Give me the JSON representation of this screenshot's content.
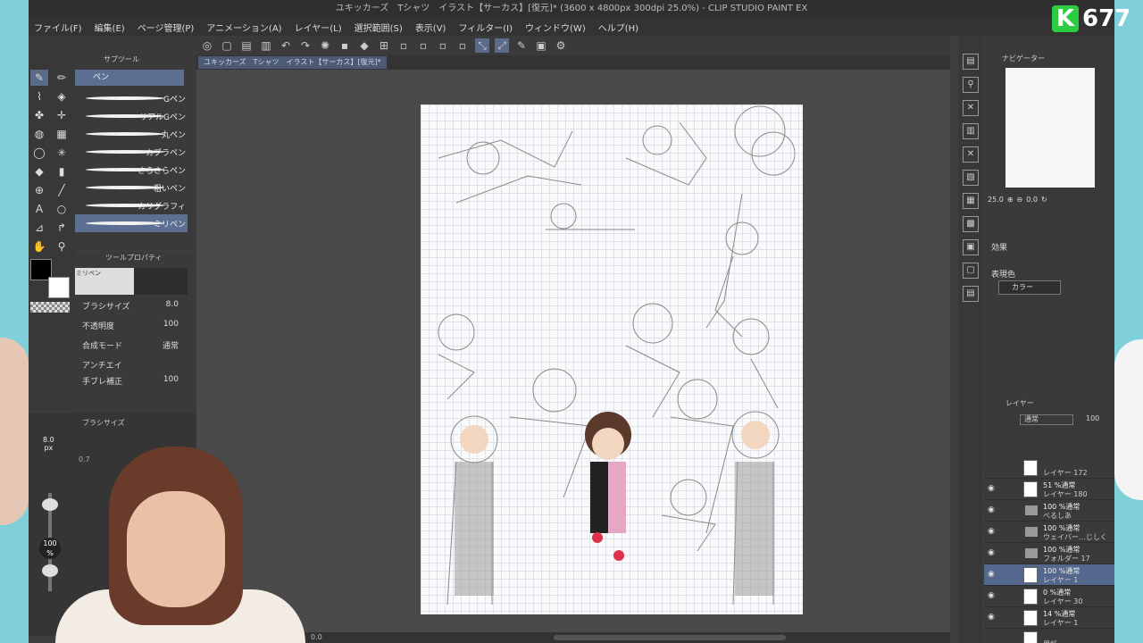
{
  "window": {
    "title": "ユキッカーズ　Tシャツ　イラスト【サーカス】[復元]* (3600 x 4800px 300dpi 25.0%)  - CLIP STUDIO PAINT EX"
  },
  "menu": [
    "ファイル(F)",
    "編集(E)",
    "ページ管理(P)",
    "アニメーション(A)",
    "レイヤー(L)",
    "選択範囲(S)",
    "表示(V)",
    "フィルター(I)",
    "ウィンドウ(W)",
    "ヘルプ(H)"
  ],
  "doc_tab": {
    "label": "ユキッカーズ　Tシャツ　イラスト【サーカス】[復元]*"
  },
  "subtool": {
    "header": "サブツール",
    "tab": "ペン",
    "brushes": [
      "Gペン",
      "リアルGペン",
      "丸ペン",
      "カブラペン",
      "さらさらペン",
      "粗いペン",
      "カリグラフィ",
      "ミリペン"
    ]
  },
  "tool_property": {
    "header": "ツールプロパティ",
    "preview_label": "ミリペン",
    "brush_size_label": "ブラシサイズ",
    "brush_size_value": "8.0",
    "opacity_label": "不透明度",
    "opacity_value": "100",
    "blend_label": "合成モード",
    "blend_value": "通常",
    "antialias_label": "アンチエイ",
    "stabilize_label": "手ブレ補正",
    "stabilize_value": "100"
  },
  "brush_size_panel": {
    "header": "ブラシサイズ",
    "size": "8.0",
    "unit": "px",
    "secondary": "0.7",
    "percent": "100",
    "percent_unit": "%"
  },
  "navigator": {
    "header": "ナビゲーター",
    "zoom": "25.0",
    "rotate": "0.0"
  },
  "effect_panel": {
    "header": "効果",
    "expression_label": "表現色",
    "expression_value": "カラー"
  },
  "layer_panel": {
    "header": "レイヤー",
    "blend": "通常",
    "opacity": "100",
    "layers": [
      {
        "mode": "",
        "name": "レイヤー 172",
        "selected": false,
        "folder": false
      },
      {
        "mode": "51 %通常",
        "name": "レイヤー 180",
        "selected": false,
        "folder": false
      },
      {
        "mode": "100 %通常",
        "name": "べるしあ",
        "selected": false,
        "folder": true
      },
      {
        "mode": "100 %通常",
        "name": "ウェイバー…じしく",
        "selected": false,
        "folder": true
      },
      {
        "mode": "100 %通常",
        "name": "フォルダー 17",
        "selected": false,
        "folder": true
      },
      {
        "mode": "100 %通常",
        "name": "レイヤー 1",
        "selected": true,
        "folder": false
      },
      {
        "mode": "0 %通常",
        "name": "レイヤー 30",
        "selected": false,
        "folder": false
      },
      {
        "mode": "14 %通常",
        "name": "レイヤー 1",
        "selected": false,
        "folder": false
      },
      {
        "mode": "",
        "name": "用紙",
        "selected": false,
        "folder": false
      }
    ]
  },
  "status": {
    "zoom_readout": "0.0"
  },
  "overlay": {
    "badge_letter": "K",
    "badge_number": "677"
  }
}
